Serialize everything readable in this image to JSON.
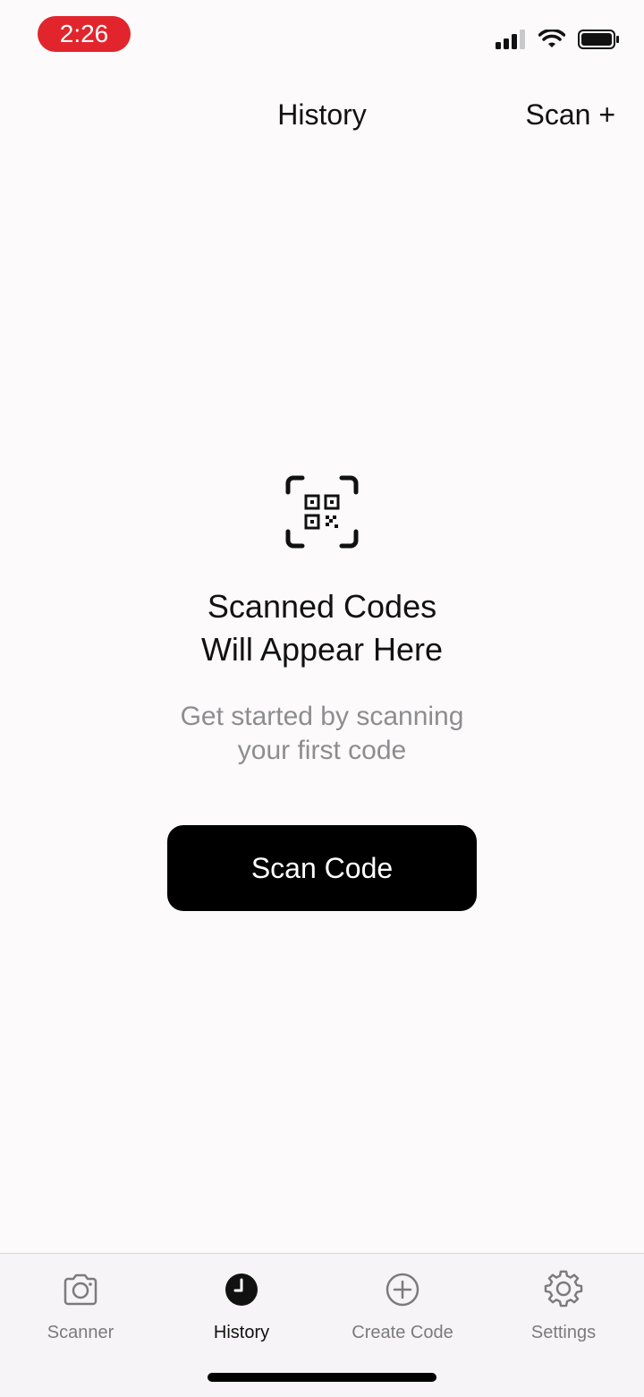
{
  "status_bar": {
    "time": "2:26",
    "time_pill_color": "#e2252c",
    "icons": [
      "cellular-signal-icon",
      "wifi-icon",
      "battery-icon"
    ]
  },
  "nav": {
    "title": "History",
    "action_label": "Scan +"
  },
  "empty_state": {
    "icon": "qr-code-scan-icon",
    "title_line1": "Scanned Codes",
    "title_line2": "Will Appear Here",
    "subtitle_line1": "Get started by scanning",
    "subtitle_line2": "your first code",
    "button_label": "Scan Code"
  },
  "tabs": [
    {
      "label": "Scanner",
      "icon": "camera-icon",
      "active": false
    },
    {
      "label": "History",
      "icon": "clock-icon",
      "active": true
    },
    {
      "label": "Create Code",
      "icon": "plus-circle-icon",
      "active": false
    },
    {
      "label": "Settings",
      "icon": "gear-icon",
      "active": false
    }
  ],
  "colors": {
    "background": "#fcfafb",
    "primary_button": "#000000",
    "secondary_text": "#8d8d90",
    "inactive_tab": "#7b7b7f"
  }
}
